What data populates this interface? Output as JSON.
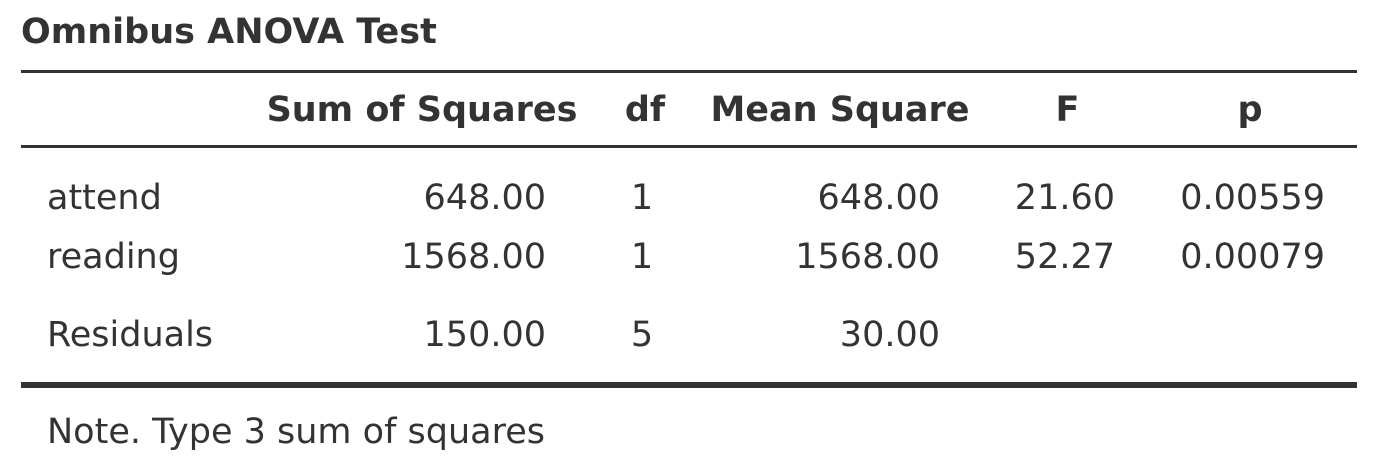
{
  "title": "Omnibus ANOVA Test",
  "table": {
    "headers": {
      "label": "",
      "sum_of_squares": "Sum of Squares",
      "df": "df",
      "mean_square": "Mean Square",
      "f": "F",
      "p": "p"
    },
    "rows": [
      {
        "term": "attend",
        "sum_of_squares": "648.00",
        "df": "1",
        "mean_square": "648.00",
        "f": "21.60",
        "p": "0.00559"
      },
      {
        "term": "reading",
        "sum_of_squares": "1568.00",
        "df": "1",
        "mean_square": "1568.00",
        "f": "52.27",
        "p": "0.00079"
      },
      {
        "term": "Residuals",
        "sum_of_squares": "150.00",
        "df": "5",
        "mean_square": "30.00",
        "f": "",
        "p": ""
      }
    ]
  },
  "note": "Note. Type 3 sum of squares",
  "colors": {
    "text": "#333333",
    "rule": "#333333",
    "background": "#ffffff"
  }
}
